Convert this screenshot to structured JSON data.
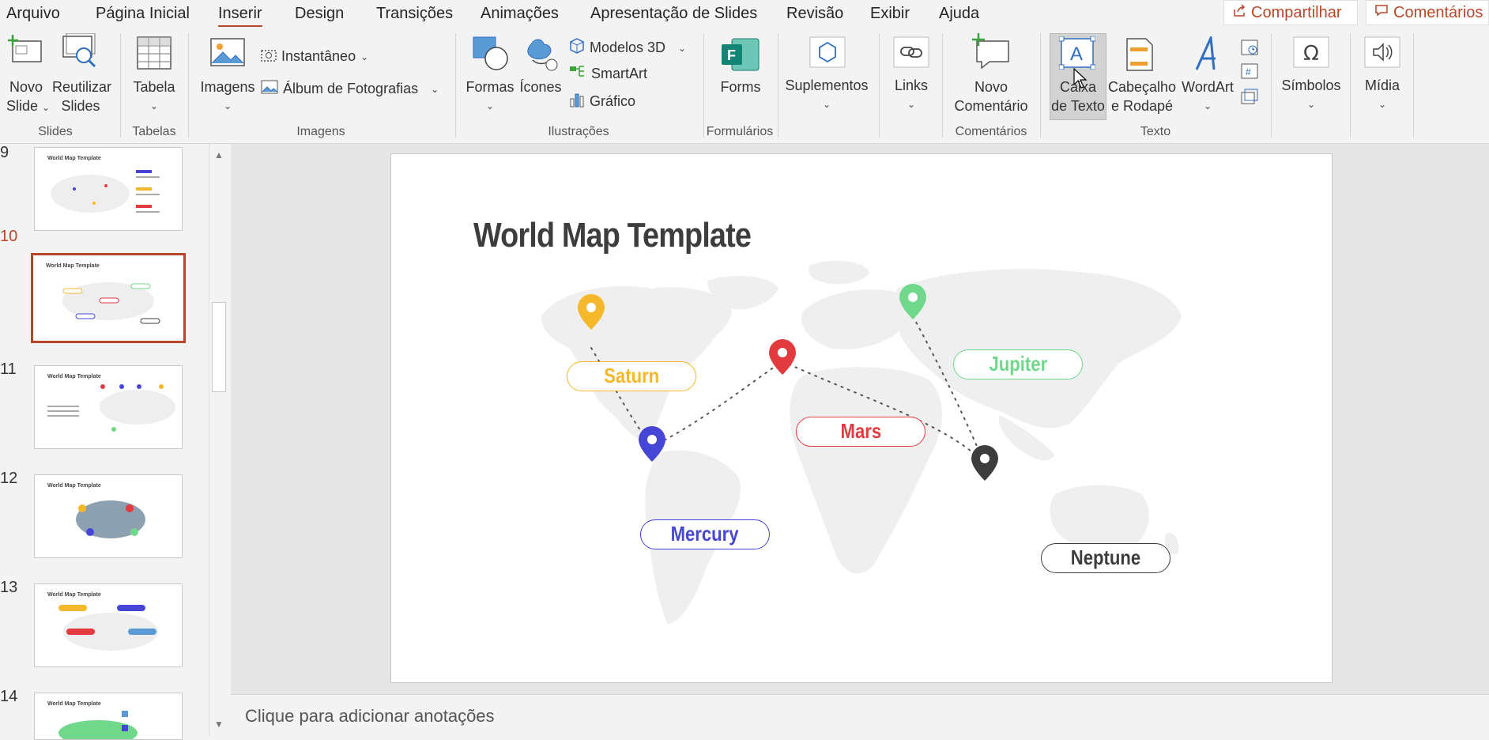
{
  "menu": {
    "tabs": [
      "Arquivo",
      "Página Inicial",
      "Inserir",
      "Design",
      "Transições",
      "Animações",
      "Apresentação de Slides",
      "Revisão",
      "Exibir",
      "Ajuda"
    ],
    "active_tab": "Inserir",
    "share_label": "Compartilhar",
    "comments_label": "Comentários"
  },
  "ribbon": {
    "groups": {
      "slides": "Slides",
      "tabelas": "Tabelas",
      "imagens": "Imagens",
      "ilustracoes": "Ilustrações",
      "formularios": "Formulários",
      "comentarios": "Comentários",
      "texto": "Texto"
    },
    "buttons": {
      "novo_slide_1": "Novo",
      "novo_slide_2": "Slide",
      "reutilizar_1": "Reutilizar",
      "reutilizar_2": "Slides",
      "tabela": "Tabela",
      "imagens": "Imagens",
      "instantaneo": "Instantâneo",
      "album": "Álbum de Fotografias",
      "formas": "Formas",
      "icones": "Ícones",
      "modelos3d": "Modelos 3D",
      "smartart": "SmartArt",
      "grafico": "Gráfico",
      "forms": "Forms",
      "suplementos": "Suplementos",
      "links": "Links",
      "novo_comentario_1": "Novo",
      "novo_comentario_2": "Comentário",
      "caixa_texto_1": "Caixa",
      "caixa_texto_2": "de Texto",
      "cabecalho_1": "Cabeçalho",
      "cabecalho_2": "e Rodapé",
      "wordart": "WordArt",
      "simbolos": "Símbolos",
      "midia": "Mídia"
    }
  },
  "thumbnails": [
    {
      "num": "9",
      "title": "World Map Template"
    },
    {
      "num": "10",
      "title": "World Map Template"
    },
    {
      "num": "11",
      "title": "World Map Template"
    },
    {
      "num": "12",
      "title": "World Map Template"
    },
    {
      "num": "13",
      "title": "World Map Template"
    },
    {
      "num": "14",
      "title": "World Map Template"
    }
  ],
  "active_slide": "10",
  "slide": {
    "title": "World Map Template",
    "planets": {
      "saturn": {
        "label": "Saturn",
        "color": "#f6b82b"
      },
      "jupiter": {
        "label": "Jupiter",
        "color": "#6fd88a"
      },
      "mars": {
        "label": "Mars",
        "color": "#e23a3f"
      },
      "mercury": {
        "label": "Mercury",
        "color": "#4646d6"
      },
      "neptune": {
        "label": "Neptune",
        "color": "#3d3d3d"
      }
    }
  },
  "notes_placeholder": "Clique para adicionar anotações",
  "colors": {
    "accent": "#b7472a"
  }
}
